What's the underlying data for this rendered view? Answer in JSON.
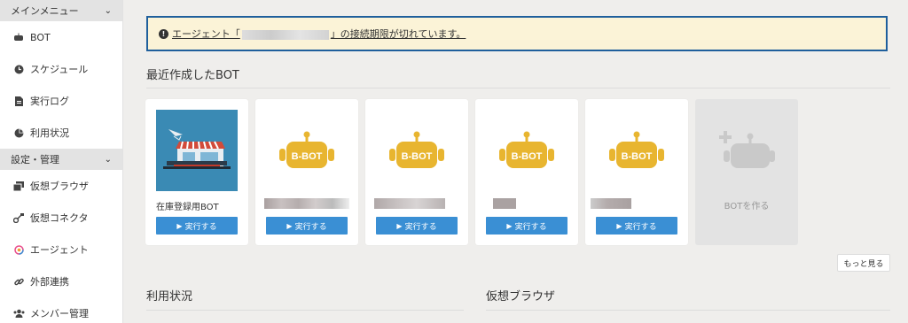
{
  "sidebar": {
    "main_menu_header": "メインメニュー",
    "settings_header": "設定・管理",
    "main_items": [
      {
        "label": "BOT",
        "icon": "robot-icon"
      },
      {
        "label": "スケジュール",
        "icon": "clock-icon"
      },
      {
        "label": "実行ログ",
        "icon": "document-icon"
      },
      {
        "label": "利用状況",
        "icon": "pie-chart-icon"
      }
    ],
    "settings_items": [
      {
        "label": "仮想ブラウザ",
        "icon": "browser-windows-icon"
      },
      {
        "label": "仮想コネクタ",
        "icon": "connector-icon"
      },
      {
        "label": "エージェント",
        "icon": "agent-icon"
      },
      {
        "label": "外部連携",
        "icon": "link-icon"
      },
      {
        "label": "メンバー管理",
        "icon": "users-icon"
      }
    ]
  },
  "alert": {
    "prefix": "エージェント「",
    "suffix": "」の接続期限が切れています。"
  },
  "recent_bots": {
    "title": "最近作成したBOT",
    "cards": [
      {
        "name": "在庫登録用BOT",
        "run_label": "実行する"
      },
      {
        "name": "",
        "run_label": "実行する",
        "bot_badge": "B-BOT"
      },
      {
        "name": "",
        "run_label": "実行する",
        "bot_badge": "B-BOT"
      },
      {
        "name": "",
        "run_label": "実行する",
        "bot_badge": "B-BOT"
      },
      {
        "name": "",
        "run_label": "実行する",
        "bot_badge": "B-BOT"
      }
    ],
    "create_label": "BOTを作る",
    "more_label": "もっと見る"
  },
  "usage": {
    "title": "利用状況"
  },
  "virtual_browser": {
    "title": "仮想ブラウザ"
  },
  "colors": {
    "accent": "#3a8fd4",
    "alert_border": "#1f5f9c",
    "alert_bg": "#fbf3d7",
    "bot_yellow": "#e8b530"
  }
}
